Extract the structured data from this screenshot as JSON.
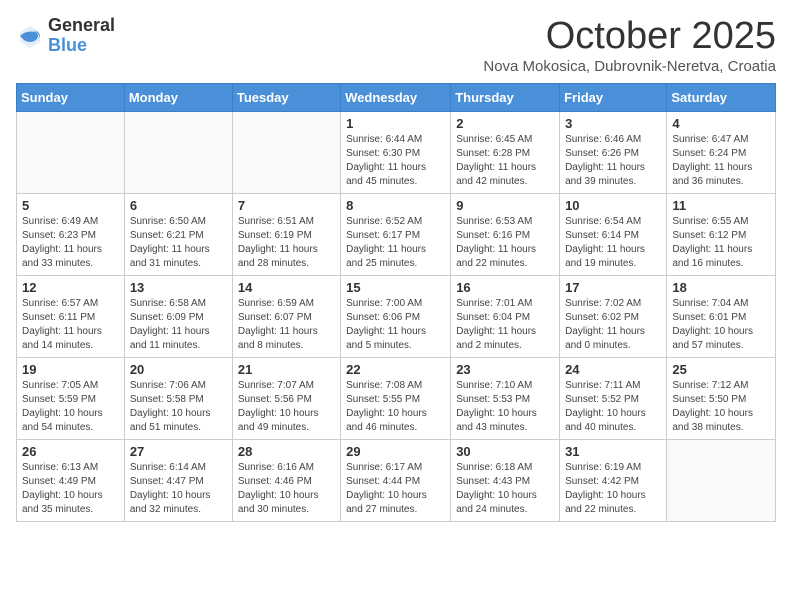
{
  "header": {
    "logo_general": "General",
    "logo_blue": "Blue",
    "month_title": "October 2025",
    "location": "Nova Mokosica, Dubrovnik-Neretva, Croatia"
  },
  "weekdays": [
    "Sunday",
    "Monday",
    "Tuesday",
    "Wednesday",
    "Thursday",
    "Friday",
    "Saturday"
  ],
  "weeks": [
    [
      {
        "day": "",
        "info": ""
      },
      {
        "day": "",
        "info": ""
      },
      {
        "day": "",
        "info": ""
      },
      {
        "day": "1",
        "info": "Sunrise: 6:44 AM\nSunset: 6:30 PM\nDaylight: 11 hours and 45 minutes."
      },
      {
        "day": "2",
        "info": "Sunrise: 6:45 AM\nSunset: 6:28 PM\nDaylight: 11 hours and 42 minutes."
      },
      {
        "day": "3",
        "info": "Sunrise: 6:46 AM\nSunset: 6:26 PM\nDaylight: 11 hours and 39 minutes."
      },
      {
        "day": "4",
        "info": "Sunrise: 6:47 AM\nSunset: 6:24 PM\nDaylight: 11 hours and 36 minutes."
      }
    ],
    [
      {
        "day": "5",
        "info": "Sunrise: 6:49 AM\nSunset: 6:23 PM\nDaylight: 11 hours and 33 minutes."
      },
      {
        "day": "6",
        "info": "Sunrise: 6:50 AM\nSunset: 6:21 PM\nDaylight: 11 hours and 31 minutes."
      },
      {
        "day": "7",
        "info": "Sunrise: 6:51 AM\nSunset: 6:19 PM\nDaylight: 11 hours and 28 minutes."
      },
      {
        "day": "8",
        "info": "Sunrise: 6:52 AM\nSunset: 6:17 PM\nDaylight: 11 hours and 25 minutes."
      },
      {
        "day": "9",
        "info": "Sunrise: 6:53 AM\nSunset: 6:16 PM\nDaylight: 11 hours and 22 minutes."
      },
      {
        "day": "10",
        "info": "Sunrise: 6:54 AM\nSunset: 6:14 PM\nDaylight: 11 hours and 19 minutes."
      },
      {
        "day": "11",
        "info": "Sunrise: 6:55 AM\nSunset: 6:12 PM\nDaylight: 11 hours and 16 minutes."
      }
    ],
    [
      {
        "day": "12",
        "info": "Sunrise: 6:57 AM\nSunset: 6:11 PM\nDaylight: 11 hours and 14 minutes."
      },
      {
        "day": "13",
        "info": "Sunrise: 6:58 AM\nSunset: 6:09 PM\nDaylight: 11 hours and 11 minutes."
      },
      {
        "day": "14",
        "info": "Sunrise: 6:59 AM\nSunset: 6:07 PM\nDaylight: 11 hours and 8 minutes."
      },
      {
        "day": "15",
        "info": "Sunrise: 7:00 AM\nSunset: 6:06 PM\nDaylight: 11 hours and 5 minutes."
      },
      {
        "day": "16",
        "info": "Sunrise: 7:01 AM\nSunset: 6:04 PM\nDaylight: 11 hours and 2 minutes."
      },
      {
        "day": "17",
        "info": "Sunrise: 7:02 AM\nSunset: 6:02 PM\nDaylight: 11 hours and 0 minutes."
      },
      {
        "day": "18",
        "info": "Sunrise: 7:04 AM\nSunset: 6:01 PM\nDaylight: 10 hours and 57 minutes."
      }
    ],
    [
      {
        "day": "19",
        "info": "Sunrise: 7:05 AM\nSunset: 5:59 PM\nDaylight: 10 hours and 54 minutes."
      },
      {
        "day": "20",
        "info": "Sunrise: 7:06 AM\nSunset: 5:58 PM\nDaylight: 10 hours and 51 minutes."
      },
      {
        "day": "21",
        "info": "Sunrise: 7:07 AM\nSunset: 5:56 PM\nDaylight: 10 hours and 49 minutes."
      },
      {
        "day": "22",
        "info": "Sunrise: 7:08 AM\nSunset: 5:55 PM\nDaylight: 10 hours and 46 minutes."
      },
      {
        "day": "23",
        "info": "Sunrise: 7:10 AM\nSunset: 5:53 PM\nDaylight: 10 hours and 43 minutes."
      },
      {
        "day": "24",
        "info": "Sunrise: 7:11 AM\nSunset: 5:52 PM\nDaylight: 10 hours and 40 minutes."
      },
      {
        "day": "25",
        "info": "Sunrise: 7:12 AM\nSunset: 5:50 PM\nDaylight: 10 hours and 38 minutes."
      }
    ],
    [
      {
        "day": "26",
        "info": "Sunrise: 6:13 AM\nSunset: 4:49 PM\nDaylight: 10 hours and 35 minutes."
      },
      {
        "day": "27",
        "info": "Sunrise: 6:14 AM\nSunset: 4:47 PM\nDaylight: 10 hours and 32 minutes."
      },
      {
        "day": "28",
        "info": "Sunrise: 6:16 AM\nSunset: 4:46 PM\nDaylight: 10 hours and 30 minutes."
      },
      {
        "day": "29",
        "info": "Sunrise: 6:17 AM\nSunset: 4:44 PM\nDaylight: 10 hours and 27 minutes."
      },
      {
        "day": "30",
        "info": "Sunrise: 6:18 AM\nSunset: 4:43 PM\nDaylight: 10 hours and 24 minutes."
      },
      {
        "day": "31",
        "info": "Sunrise: 6:19 AM\nSunset: 4:42 PM\nDaylight: 10 hours and 22 minutes."
      },
      {
        "day": "",
        "info": ""
      }
    ]
  ]
}
